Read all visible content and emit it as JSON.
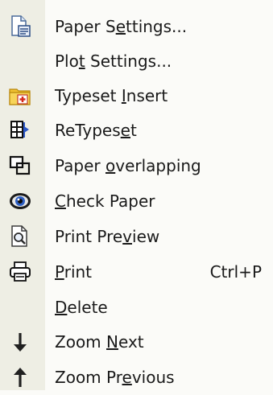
{
  "menu": {
    "items": [
      {
        "pre": "Paper S",
        "acc": "e",
        "post": "ttings...",
        "shortcut": "",
        "icon": "page-settings-icon"
      },
      {
        "pre": "Plo",
        "acc": "t",
        "post": " Settings...",
        "shortcut": "",
        "icon": ""
      },
      {
        "pre": "Typeset ",
        "acc": "I",
        "post": "nsert",
        "shortcut": "",
        "icon": "folder-insert-icon"
      },
      {
        "pre": "ReTypes",
        "acc": "e",
        "post": "t",
        "shortcut": "",
        "icon": "retypeset-icon"
      },
      {
        "pre": "Paper ",
        "acc": "o",
        "post": "verlapping",
        "shortcut": "",
        "icon": "overlap-icon"
      },
      {
        "pre": "",
        "acc": "C",
        "post": "heck Paper",
        "shortcut": "",
        "icon": "eye-icon"
      },
      {
        "pre": "Print Pre",
        "acc": "v",
        "post": "iew",
        "shortcut": "",
        "icon": "print-preview-icon"
      },
      {
        "pre": "",
        "acc": "P",
        "post": "rint",
        "shortcut": "Ctrl+P",
        "icon": "printer-icon"
      },
      {
        "pre": "",
        "acc": "D",
        "post": "elete",
        "shortcut": "",
        "icon": ""
      },
      {
        "pre": "Zoom ",
        "acc": "N",
        "post": "ext",
        "shortcut": "",
        "icon": "arrow-down-icon"
      },
      {
        "pre": "Zoom Pr",
        "acc": "e",
        "post": "vious",
        "shortcut": "",
        "icon": "arrow-up-icon"
      }
    ]
  }
}
